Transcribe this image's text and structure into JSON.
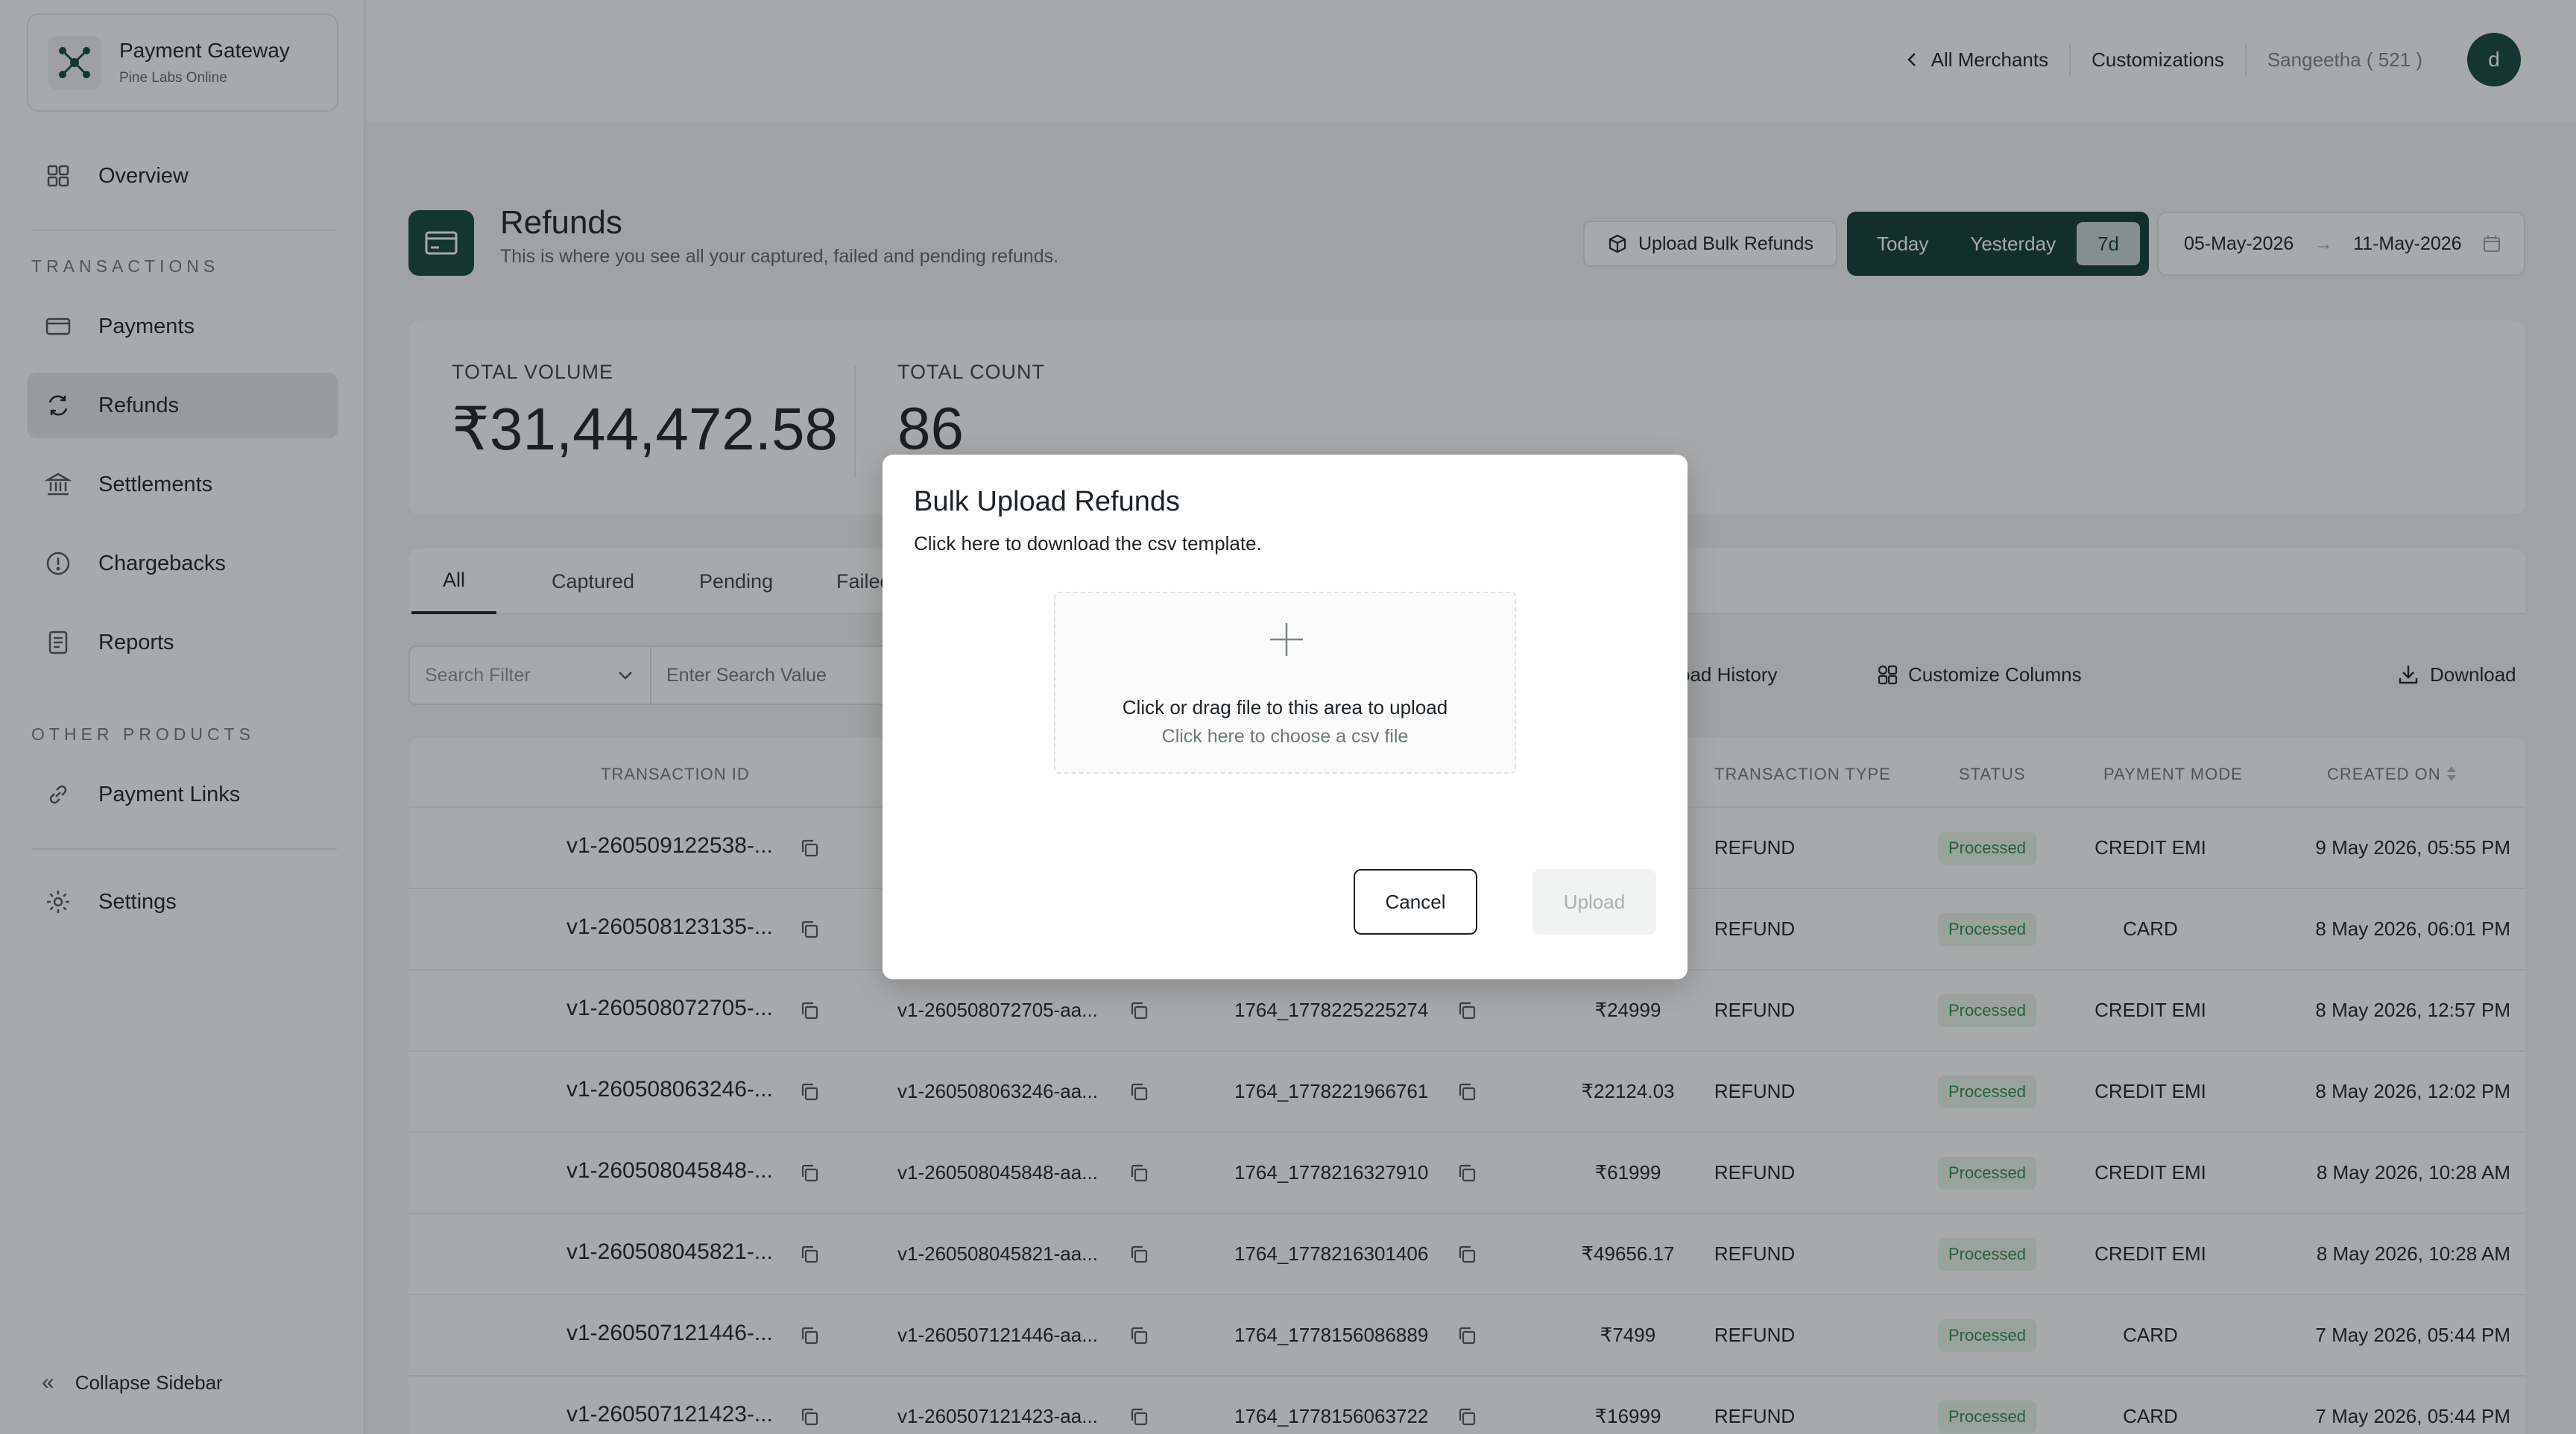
{
  "brand": {
    "title": "Payment Gateway",
    "subtitle": "Pine Labs Online"
  },
  "sidebar": {
    "overview": "Overview",
    "section_transactions": "TRANSACTIONS",
    "payments": "Payments",
    "refunds": "Refunds",
    "settlements": "Settlements",
    "chargebacks": "Chargebacks",
    "reports": "Reports",
    "section_other": "OTHER PRODUCTS",
    "payment_links": "Payment Links",
    "settings": "Settings",
    "collapse": "Collapse Sidebar",
    "active_item": "Refunds"
  },
  "header": {
    "all_merchants": "All Merchants",
    "customizations": "Customizations",
    "user": "Sangeetha ( 521 )",
    "avatar_initial": "d"
  },
  "page": {
    "title": "Refunds",
    "subtitle": "This is where you see all your captured, failed and pending refunds.",
    "bulk_upload_label": "Upload Bulk Refunds",
    "range_today": "Today",
    "range_yesterday": "Yesterday",
    "range_7d": "7d",
    "range_selected": "7d",
    "date_from": "05-May-2026",
    "date_to": "11-May-2026"
  },
  "stats": {
    "volume_label": "TOTAL VOLUME",
    "volume_value": "₹31,44,472.58",
    "count_label": "TOTAL COUNT",
    "count_value": "86"
  },
  "tabs": {
    "all": "All",
    "captured": "Captured",
    "pending": "Pending",
    "failed": "Failed",
    "active": "All"
  },
  "filters": {
    "search_filter_placeholder": "Search Filter",
    "search_value_placeholder": "Enter Search Value",
    "upload_history": "Upload History",
    "customize_columns": "Customize Columns",
    "download": "Download"
  },
  "table": {
    "headers": {
      "transaction_id": "TRANSACTION ID",
      "transaction_type": "TRANSACTION TYPE",
      "status": "STATUS",
      "payment_mode": "PAYMENT MODE",
      "created_on": "CREATED ON"
    },
    "rows": [
      {
        "txn_id": "v1-260509122538-...",
        "order_id": "",
        "ref": "",
        "amount": "",
        "type": "REFUND",
        "status": "Processed",
        "mode": "CREDIT EMI",
        "created": "9 May 2026, 05:55 PM"
      },
      {
        "txn_id": "v1-260508123135-...",
        "order_id": "",
        "ref": "",
        "amount": "",
        "type": "REFUND",
        "status": "Processed",
        "mode": "CARD",
        "created": "8 May 2026, 06:01 PM"
      },
      {
        "txn_id": "v1-260508072705-...",
        "order_id": "v1-260508072705-aa...",
        "ref": "1764_1778225225274",
        "amount": "₹24999",
        "type": "REFUND",
        "status": "Processed",
        "mode": "CREDIT EMI",
        "created": "8 May 2026, 12:57 PM"
      },
      {
        "txn_id": "v1-260508063246-...",
        "order_id": "v1-260508063246-aa...",
        "ref": "1764_1778221966761",
        "amount": "₹22124.03",
        "type": "REFUND",
        "status": "Processed",
        "mode": "CREDIT EMI",
        "created": "8 May 2026, 12:02 PM"
      },
      {
        "txn_id": "v1-260508045848-...",
        "order_id": "v1-260508045848-aa...",
        "ref": "1764_1778216327910",
        "amount": "₹61999",
        "type": "REFUND",
        "status": "Processed",
        "mode": "CREDIT EMI",
        "created": "8 May 2026, 10:28 AM"
      },
      {
        "txn_id": "v1-260508045821-...",
        "order_id": "v1-260508045821-aa...",
        "ref": "1764_1778216301406",
        "amount": "₹49656.17",
        "type": "REFUND",
        "status": "Processed",
        "mode": "CREDIT EMI",
        "created": "8 May 2026, 10:28 AM"
      },
      {
        "txn_id": "v1-260507121446-...",
        "order_id": "v1-260507121446-aa...",
        "ref": "1764_1778156086889",
        "amount": "₹7499",
        "type": "REFUND",
        "status": "Processed",
        "mode": "CARD",
        "created": "7 May 2026, 05:44 PM"
      },
      {
        "txn_id": "v1-260507121423-...",
        "order_id": "v1-260507121423-aa...",
        "ref": "1764_1778156063722",
        "amount": "₹16999",
        "type": "REFUND",
        "status": "Processed",
        "mode": "CARD",
        "created": "7 May 2026, 05:44 PM"
      }
    ]
  },
  "modal": {
    "title": "Bulk Upload Refunds",
    "template_link": "Click here to download the csv template.",
    "dropzone_main": "Click or drag file to this area to upload",
    "dropzone_sub": "Click here to choose a csv file",
    "cancel": "Cancel",
    "upload": "Upload"
  },
  "colors": {
    "brand_dark": "#12463b",
    "success": "#2e8a4c",
    "success_bg": "#e8f4ec"
  }
}
